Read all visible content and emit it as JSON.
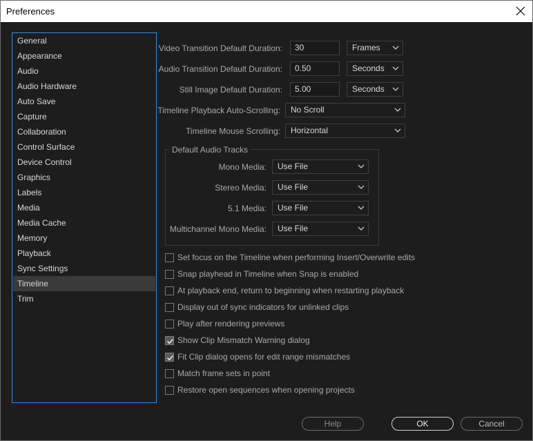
{
  "window": {
    "title": "Preferences"
  },
  "sidebar": {
    "items": [
      {
        "label": "General"
      },
      {
        "label": "Appearance"
      },
      {
        "label": "Audio"
      },
      {
        "label": "Audio Hardware"
      },
      {
        "label": "Auto Save"
      },
      {
        "label": "Capture"
      },
      {
        "label": "Collaboration"
      },
      {
        "label": "Control Surface"
      },
      {
        "label": "Device Control"
      },
      {
        "label": "Graphics"
      },
      {
        "label": "Labels"
      },
      {
        "label": "Media"
      },
      {
        "label": "Media Cache"
      },
      {
        "label": "Memory"
      },
      {
        "label": "Playback"
      },
      {
        "label": "Sync Settings"
      },
      {
        "label": "Timeline"
      },
      {
        "label": "Trim"
      }
    ],
    "selected": "Timeline"
  },
  "timeline": {
    "video_transition": {
      "label": "Video Transition Default Duration:",
      "value": "30",
      "unit": "Frames"
    },
    "audio_transition": {
      "label": "Audio Transition Default Duration:",
      "value": "0.50",
      "unit": "Seconds"
    },
    "still_image": {
      "label": "Still Image Default Duration:",
      "value": "5.00",
      "unit": "Seconds"
    },
    "playback_autoscroll": {
      "label": "Timeline Playback Auto-Scrolling:",
      "value": "No Scroll"
    },
    "mouse_scrolling": {
      "label": "Timeline Mouse Scrolling:",
      "value": "Horizontal"
    },
    "default_audio_tracks": {
      "title": "Default Audio Tracks",
      "mono": {
        "label": "Mono Media:",
        "value": "Use File"
      },
      "stereo": {
        "label": "Stereo Media:",
        "value": "Use File"
      },
      "five_one": {
        "label": "5.1 Media:",
        "value": "Use File"
      },
      "multichannel_mono": {
        "label": "Multichannel Mono Media:",
        "value": "Use File"
      }
    },
    "checkboxes": [
      {
        "label": "Set focus on the Timeline when performing Insert/Overwrite edits",
        "checked": false
      },
      {
        "label": "Snap playhead in Timeline when Snap is enabled",
        "checked": false
      },
      {
        "label": "At playback end, return to beginning when restarting playback",
        "checked": false
      },
      {
        "label": "Display out of sync indicators for unlinked clips",
        "checked": false
      },
      {
        "label": "Play after rendering previews",
        "checked": false
      },
      {
        "label": "Show Clip Mismatch Warning dialog",
        "checked": true
      },
      {
        "label": "Fit Clip dialog opens for edit range mismatches",
        "checked": true
      },
      {
        "label": "Match frame sets in point",
        "checked": false
      },
      {
        "label": "Restore open sequences when opening projects",
        "checked": false
      }
    ]
  },
  "buttons": {
    "help": "Help",
    "ok": "OK",
    "cancel": "Cancel"
  },
  "colors": {
    "background": "#1d1d1d",
    "selection": "#3a3a3a",
    "focus_border": "#2d8ceb"
  },
  "icons": {
    "close": "close-icon",
    "dropdown": "chevron-down-icon",
    "check": "check-icon"
  }
}
